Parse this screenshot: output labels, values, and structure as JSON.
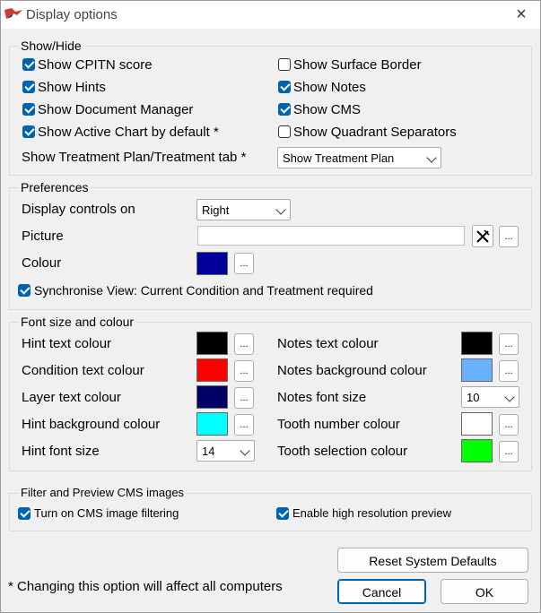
{
  "window": {
    "title": "Display options",
    "close_icon": "×"
  },
  "show_hide": {
    "legend": "Show/Hide",
    "checkboxes": [
      {
        "label": "Show CPITN score",
        "checked": true
      },
      {
        "label": "Show Hints",
        "checked": true
      },
      {
        "label": "Show Document Manager",
        "checked": true
      },
      {
        "label": "Show Active Chart by default *",
        "checked": true
      },
      {
        "label": "Show Surface Border",
        "checked": false
      },
      {
        "label": "Show Notes",
        "checked": true
      },
      {
        "label": "Show CMS",
        "checked": true
      },
      {
        "label": "Show Quadrant Separators",
        "checked": false
      }
    ],
    "treatment_tab_label": "Show Treatment Plan/Treatment tab *",
    "treatment_tab_value": "Show Treatment Plan"
  },
  "preferences": {
    "legend": "Preferences",
    "display_controls_label": "Display controls on",
    "display_controls_value": "Right",
    "picture_label": "Picture",
    "picture_value": "",
    "colour_label": "Colour",
    "colour_value": "#000099",
    "dots_label": "...",
    "sync_label": "Synchronise View: Current Condition and Treatment required",
    "sync_checked": true
  },
  "font": {
    "legend": "Font size and colour",
    "hint_text_colour": {
      "label": "Hint text colour",
      "color": "#000000"
    },
    "condition_text_colour": {
      "label": "Condition text colour",
      "color": "#ff0000"
    },
    "layer_text_colour": {
      "label": "Layer text colour",
      "color": "#000066"
    },
    "hint_background_colour": {
      "label": "Hint background colour",
      "color": "#00ffff"
    },
    "hint_font_size": {
      "label": "Hint font size",
      "value": "14"
    },
    "notes_text_colour": {
      "label": "Notes text colour",
      "color": "#000000"
    },
    "notes_background_colour": {
      "label": "Notes background colour",
      "color": "#66b2ff"
    },
    "notes_font_size": {
      "label": "Notes font size",
      "value": "10"
    },
    "tooth_number_colour": {
      "label": "Tooth number colour",
      "color": "#ffffff"
    },
    "tooth_selection_colour": {
      "label": "Tooth selection colour",
      "color": "#00ff00"
    }
  },
  "cms": {
    "legend": "Filter and Preview CMS images",
    "filtering_label": "Turn on CMS image filtering",
    "filtering_checked": true,
    "hires_label": "Enable high resolution preview",
    "hires_checked": true
  },
  "footer": {
    "note": "* Changing this option will affect all computers",
    "reset_label": "Reset System Defaults",
    "cancel_label": "Cancel",
    "ok_label": "OK"
  },
  "colors": {
    "accent": "#0063b1",
    "background": "#f0f0f0"
  }
}
